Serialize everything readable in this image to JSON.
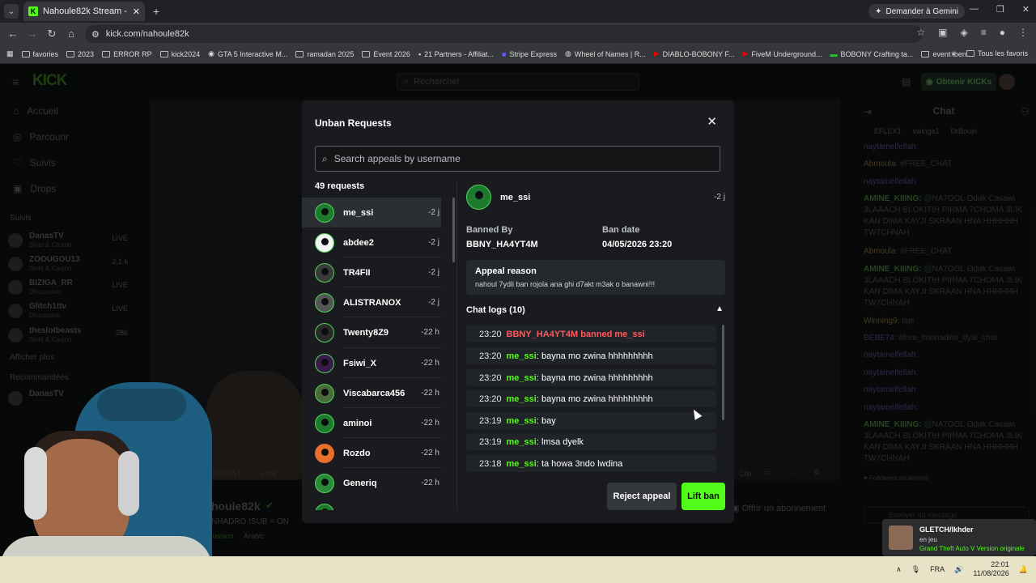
{
  "browser": {
    "tab_title": "Nahoule82k Stream - Watch Liv",
    "gemini": "Demander à Gemini",
    "url": "kick.com/nahoule82k",
    "bookmarks": [
      "favories",
      "2023",
      "ERROR RP",
      "kick2024",
      "GTA 5 Interactive M...",
      "ramadan 2025",
      "Event 2026",
      "21 Partners - Affiliat...",
      "Stripe Express",
      "Wheel of Names | R...",
      "DIABLO-BOBONY F...",
      "FiveM Underground...",
      "BOBONY Crafting ta...",
      "event lben"
    ],
    "all_favorites": "Tous les favoris"
  },
  "kick": {
    "logo": "KICK",
    "search_placeholder": "Rechercher",
    "get_kicks": "Obtenir KICKs",
    "nav": [
      "Accueil",
      "Parcourir",
      "Suivis",
      "Drops"
    ],
    "followed_label": "Suivis",
    "followed": [
      {
        "name": "DanasTV",
        "cat": "Slots & Casino",
        "status": "LIVE"
      },
      {
        "name": "ZOOUGOU13",
        "cat": "Slots & Casino",
        "status": "2,1 k"
      },
      {
        "name": "BIZIGA_RR",
        "cat": "Discussion",
        "status": "LIVE"
      },
      {
        "name": "Glitch1ttv",
        "cat": "Discussion",
        "status": "LIVE"
      },
      {
        "name": "theslotbeasts",
        "cat": "Slots & Casino",
        "status": "286"
      }
    ],
    "show_more": "Afficher plus",
    "recommended_label": "Recommandées",
    "recommended": [
      {
        "name": "DanasTV"
      }
    ],
    "video_time": "00:20:51",
    "live": "LIVE",
    "clip": "Clip",
    "streamer_name": "houle82k",
    "streamer_tags": "NHADRO  !SUB = ON",
    "category": "Discussion",
    "language": "Arabic",
    "offer_sub": "Offrir un abonnement",
    "chat_title": "Chat",
    "chat_top": [
      "EFLEX1",
      "swinga1",
      "DrBoujn"
    ],
    "chat_messages": [
      {
        "user": "naytamelfellah:",
        "text": ""
      },
      {
        "user": "Abmoula:",
        "text": "#FREE_CHAT"
      },
      {
        "user": "naytamelfellah:",
        "text": ""
      },
      {
        "user": "AMINE_KIIING:",
        "text": "@NA7OOL Odak Casawi 3LAAACH BLOKITIH PIRMA 7CHOMA 3LIK KAN DIMA KAYJI SKRAAN HNA HHHHHH TW7CHNAH"
      },
      {
        "user": "Abmoula:",
        "text": "#FREE_CHAT"
      },
      {
        "user": "AMINE_KIIING:",
        "text": "@NA7OOL Odak Casawi 3LAAACH BLOKITIH PIRMA 7CHOMA 3LIK KAN DIMA KAYJI SKRAAN HNA HHHHHH TW7CHNAH"
      },
      {
        "user": "Winning9:",
        "text": "tips"
      },
      {
        "user": "BEBE74:",
        "text": "#free_lmonadilin_dyal_chat"
      },
      {
        "user": "naytamelfellah:",
        "text": ""
      },
      {
        "user": "naytamelfellah:",
        "text": ""
      },
      {
        "user": "naytamelfellah:",
        "text": ""
      },
      {
        "user": "naytamelfellah:",
        "text": ""
      },
      {
        "user": "AMINE_KIIING:",
        "text": "@NA7OOL Odak Casawi 3LAAACH BLOKITIH PIRMA 7CHOMA 3LIK KAN DIMA KAYJI SKRAAN HNA HHHHHH TW7CHNAH"
      }
    ],
    "followers_only": "Followers seulement",
    "send_placeholder": "Envoyer un message"
  },
  "notification": {
    "user": "GLETCH/lkhder",
    "status": "en jeu",
    "game": "Grand Theft Auto V Version originale"
  },
  "taskbar": {
    "lang": "FRA",
    "time": "22:01",
    "date": "11/08/2026"
  },
  "modal": {
    "title": "Unban Requests",
    "search_placeholder": "Search appeals by username",
    "count": "49 requests",
    "requests": [
      {
        "name": "me_ssi",
        "time": "-2 j"
      },
      {
        "name": "abdee2",
        "time": "-2 j"
      },
      {
        "name": "TR4FII",
        "time": "-2 j"
      },
      {
        "name": "ALISTRANOX",
        "time": "-2 j"
      },
      {
        "name": "Twenty8Z9",
        "time": "-22 h"
      },
      {
        "name": "Fsiwi_X",
        "time": "-22 h"
      },
      {
        "name": "Viscabarca456",
        "time": "-22 h"
      },
      {
        "name": "aminoi",
        "time": "-22 h"
      },
      {
        "name": "Rozdo",
        "time": "-22 h"
      },
      {
        "name": "Generiq",
        "time": "-22 h"
      }
    ],
    "detail": {
      "name": "me_ssi",
      "time": "-2 j",
      "banned_by_label": "Banned By",
      "banned_by": "BBNY_HA4YT4M",
      "ban_date_label": "Ban date",
      "ban_date": "04/05/2026 23:20",
      "appeal_label": "Appeal reason",
      "appeal_text": "nahoul 7ydli ban rojola ana ghi d7akt m3ak o banawni!!!",
      "logs_label": "Chat logs (10)",
      "logs": [
        {
          "time": "23:20",
          "user": "BBNY_HA4YT4M banned me_ssi",
          "text": "",
          "ban": true
        },
        {
          "time": "23:20",
          "user": "me_ssi",
          "text": ": bayna mo zwina hhhhhhhhh",
          "ban": false
        },
        {
          "time": "23:20",
          "user": "me_ssi",
          "text": ": bayna mo zwina hhhhhhhhh",
          "ban": false
        },
        {
          "time": "23:20",
          "user": "me_ssi",
          "text": ": bayna mo zwina hhhhhhhhh",
          "ban": false
        },
        {
          "time": "23:19",
          "user": "me_ssi",
          "text": ": bay",
          "ban": false
        },
        {
          "time": "23:19",
          "user": "me_ssi",
          "text": ": lmsa dyelk",
          "ban": false
        },
        {
          "time": "23:18",
          "user": "me_ssi",
          "text": ": ta howa 3ndo lwdina",
          "ban": false
        }
      ]
    },
    "reject_label": "Reject appeal",
    "lift_label": "Lift ban"
  },
  "colors": {
    "accent": "#53fc18",
    "ban_red": "#ff5a5f",
    "modal_bg": "#191b1f"
  }
}
